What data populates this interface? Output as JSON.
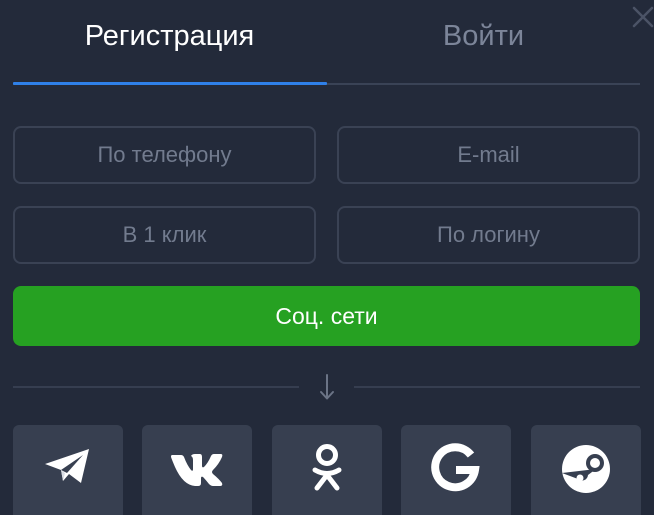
{
  "tabs": {
    "register": "Регистрация",
    "login": "Войти"
  },
  "options": {
    "phone": "По телефону",
    "email": "E-mail",
    "one_click": "В 1 клик",
    "by_login": "По логину"
  },
  "social_button": "Соц. сети",
  "social_networks": [
    "telegram-icon",
    "vk-icon",
    "odnoklassniki-icon",
    "google-icon",
    "steam-icon"
  ],
  "icons": {
    "close": "close-icon",
    "divider_arrow": "arrow-down-icon"
  },
  "colors": {
    "background": "#232a3a",
    "active_tab": "#ffffff",
    "inactive_tab": "#7c8599",
    "tab_underline": "#2f80e8",
    "option_border": "#3a4254",
    "option_text": "#727b8e",
    "social_button": "#26a122",
    "network_tile": "#373f50"
  }
}
